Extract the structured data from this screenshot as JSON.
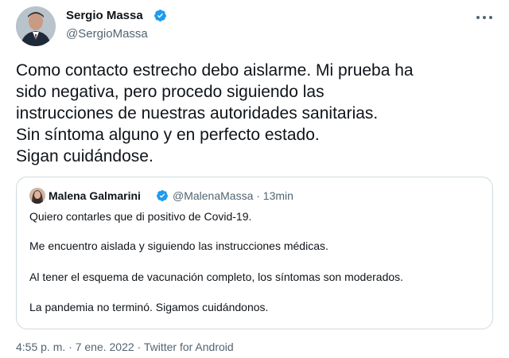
{
  "author": {
    "name": "Sergio Massa",
    "handle": "@SergioMassa",
    "avatar_icon": "profile-photo",
    "verified_icon": "verified-badge-icon"
  },
  "tweet": {
    "lines": [
      "Como contacto estrecho debo aislarme. Mi prueba ha",
      "sido negativa, pero procedo siguiendo las",
      "instrucciones de nuestras autoridades sanitarias.",
      "Sin síntoma alguno y en perfecto estado.",
      "Sigan cuidándose."
    ]
  },
  "quoted_tweet": {
    "name": "Malena Galmarini",
    "handle": "@MalenaMassa · 13min",
    "paragraphs": [
      "Quiero contarles que di positivo de Covid-19.",
      "Me encuentro aislada y siguiendo las instrucciones médicas.",
      "Al tener el esquema de vacunación completo, los síntomas son moderados.",
      "La pandemia no terminó. Sigamos cuidándonos."
    ]
  },
  "footer": {
    "timestamp": "4:55 p. m. · 7 ene. 2022 · ",
    "source": "Twitter for Android"
  },
  "colors": {
    "verified": "#1d9bf0",
    "secondary_text": "#536471",
    "border": "#cfd9de"
  }
}
